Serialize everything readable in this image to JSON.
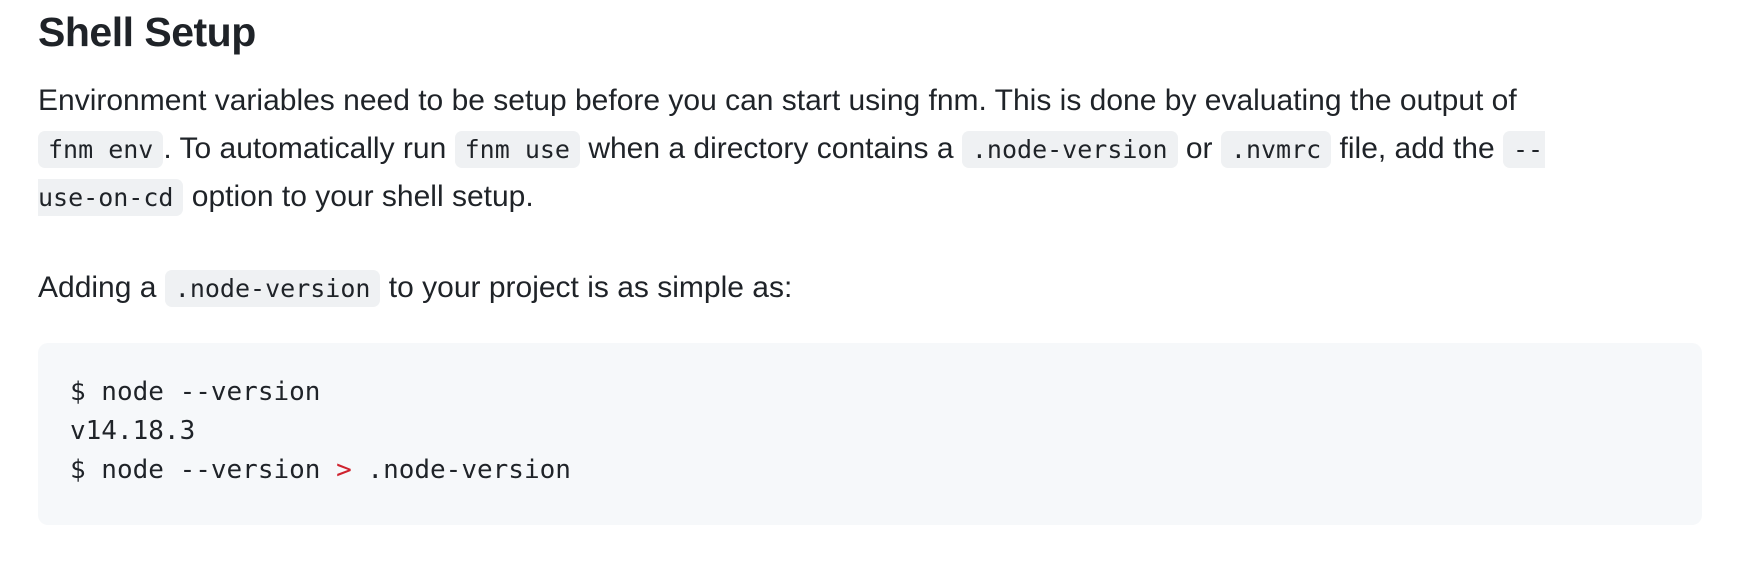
{
  "section": {
    "heading": "Shell Setup"
  },
  "intro": {
    "t1": "Environment variables need to be setup before you can start using fnm. This is done by evaluating the output of",
    "c1": "fnm env",
    "t2": ". To automatically run ",
    "c2": "fnm use",
    "t3": " when a directory contains a ",
    "c3": ".node-version",
    "t4": " or ",
    "c4": ".nvmrc",
    "t5": " file, add the ",
    "c5a": "--",
    "c5b": "use-on-cd",
    "t6": " option to your shell setup."
  },
  "adding": {
    "t1": "Adding a ",
    "c1": ".node-version",
    "t2": " to your project is as simple as:"
  },
  "codeblock": {
    "line1": "$ node --version",
    "line2": "v14.18.3",
    "line3_pre": "$ node --version ",
    "line3_op": ">",
    "line3_post": " .node-version"
  },
  "colors": {
    "inline_code_bg": "#eff1f3",
    "code_block_bg": "#f6f8fa",
    "operator": "#cf222e",
    "text": "#1f2328"
  }
}
